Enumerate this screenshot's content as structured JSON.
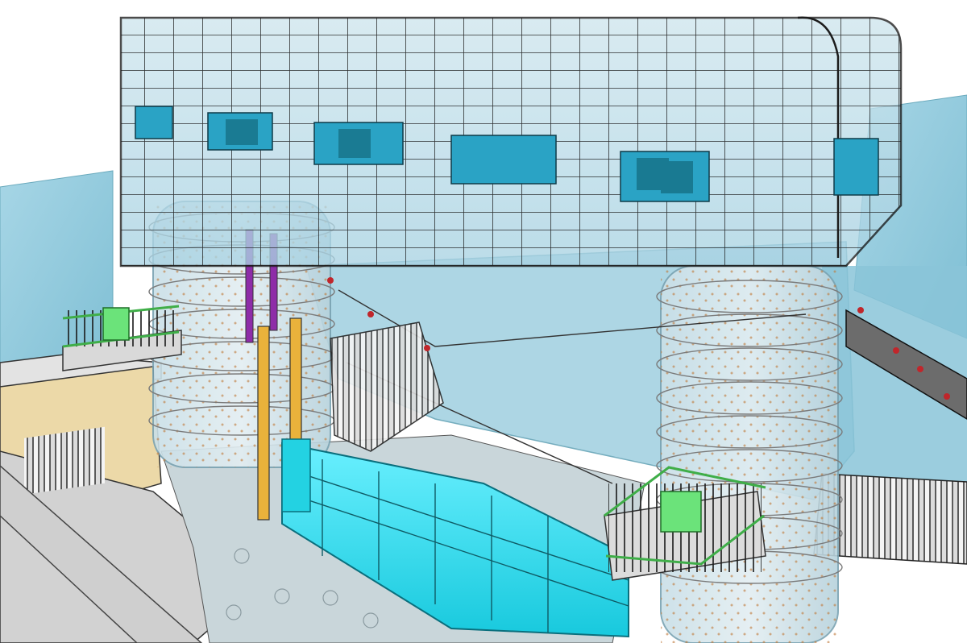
{
  "scene": {
    "title": "",
    "colors": {
      "background": "#ffffff",
      "glass": "#a9d3e3",
      "glass_light": "#cfe6ee",
      "water": "#8fc9dc",
      "frame": "#1b1b1b",
      "window_blue": "#2aa3c5",
      "gate_cyan": "#1fd3e6",
      "stair_green": "#4fcf5a",
      "guide_yellow": "#e9b23b",
      "rail_purple": "#8e2ca8",
      "concrete": "#d8d8d8",
      "pit_wall": "#e9d6a8",
      "marker_red": "#c0262b"
    },
    "components": [
      "hoist-house",
      "left-tower",
      "right-tower",
      "radial-gate",
      "left-platform",
      "right-platform",
      "gate-guides",
      "left-pit",
      "water-channel",
      "sheet-pile-wall"
    ]
  }
}
